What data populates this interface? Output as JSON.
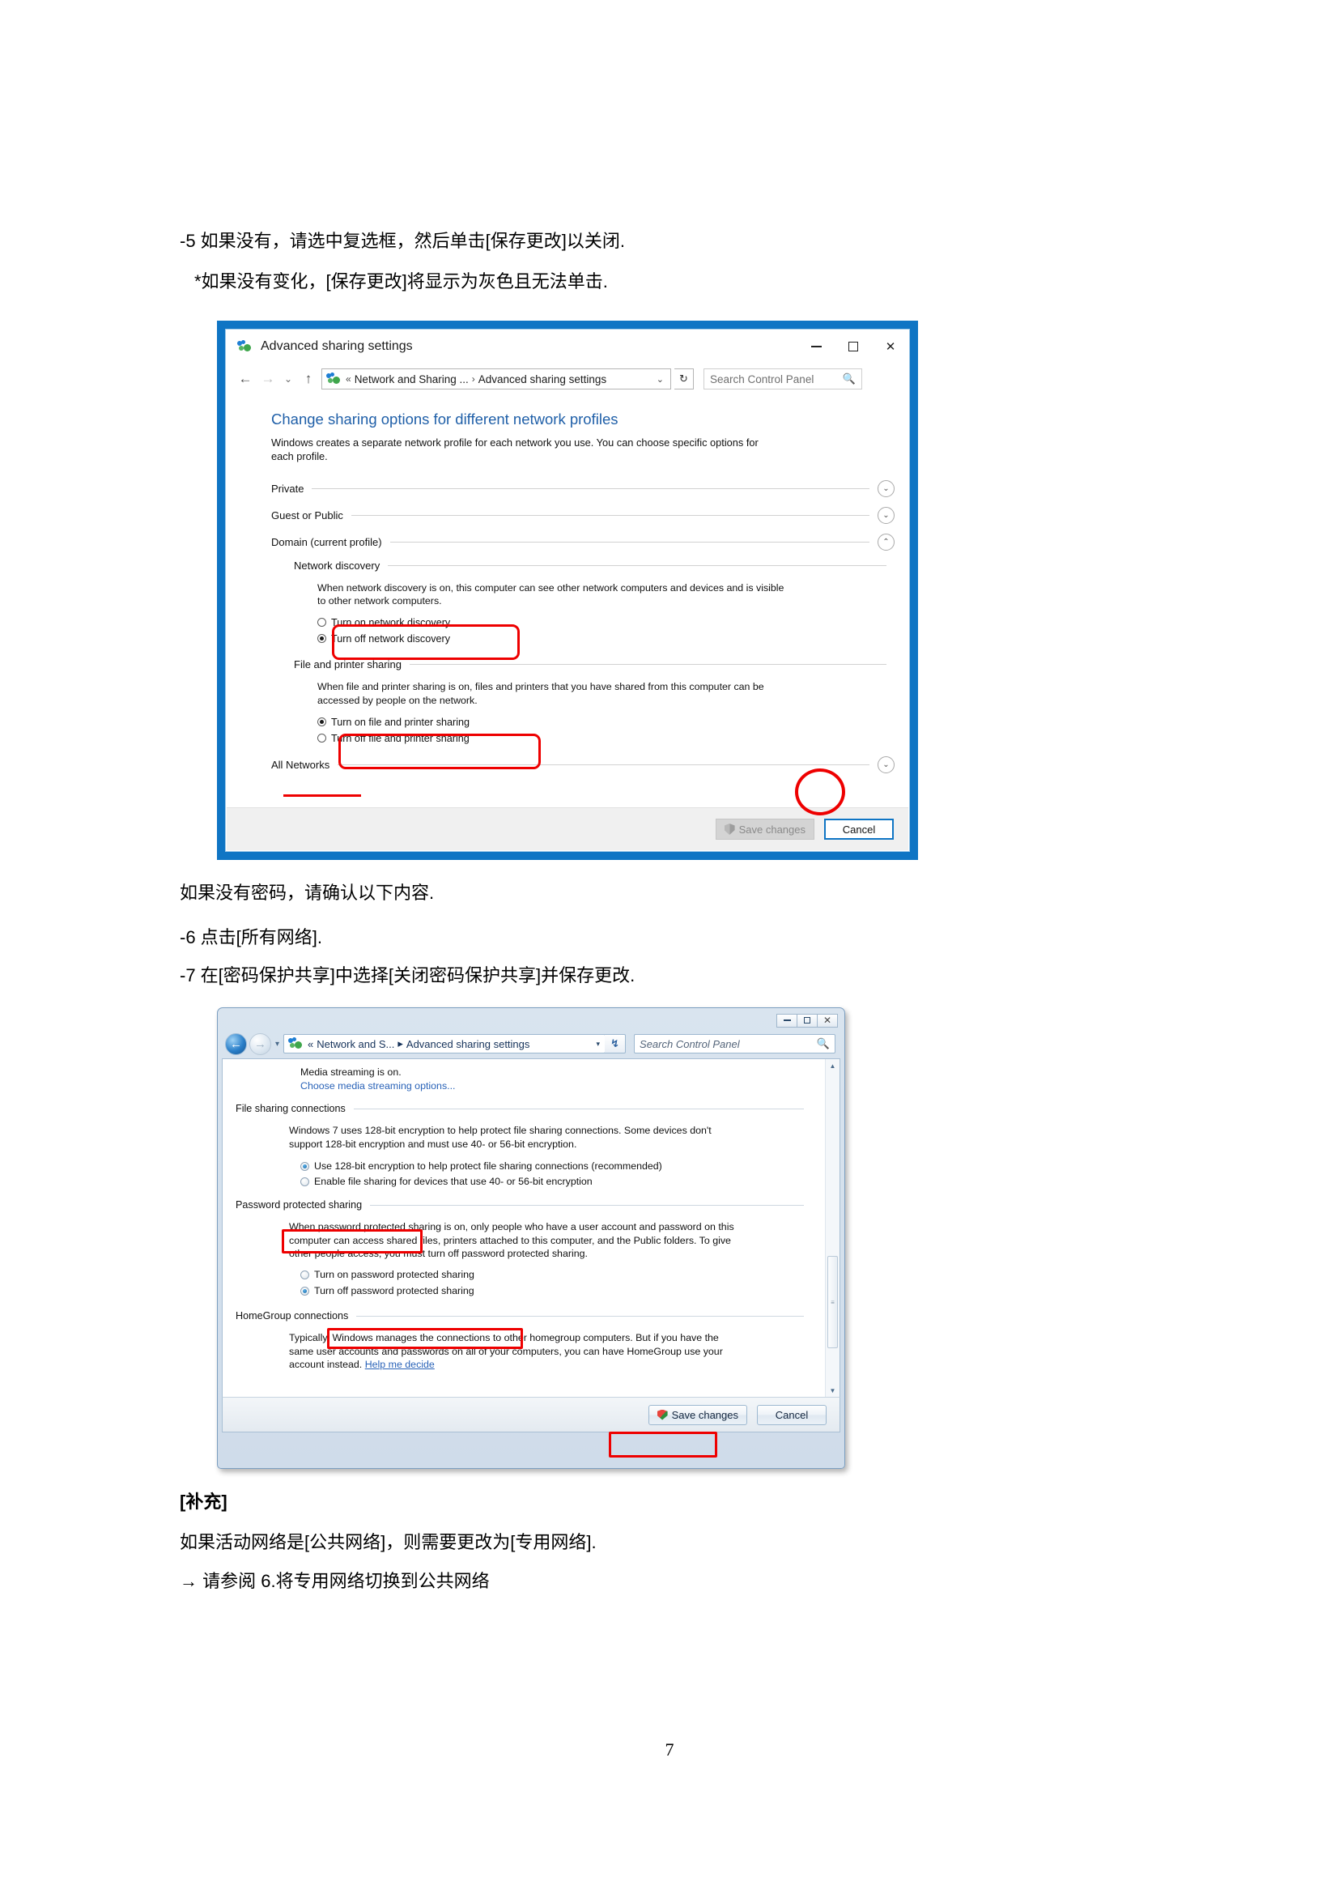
{
  "document": {
    "lines": [
      {
        "id": "l1",
        "text": "-5 如果没有，请选中复选框，然后单击[保存更改]以关闭."
      },
      {
        "id": "l2",
        "text": "*如果没有变化，[保存更改]将显示为灰色且无法单击."
      },
      {
        "id": "l3",
        "text": "如果没有密码，请确认以下内容."
      },
      {
        "id": "l4",
        "text": "-6 点击[所有网络]."
      },
      {
        "id": "l5",
        "text": "-7 在[密码保护共享]中选择[关闭密码保护共享]并保存更改."
      },
      {
        "id": "l6",
        "text": "[补充]"
      },
      {
        "id": "l7",
        "text": "如果活动网络是[公共网络]，则需要更改为[专用网络]."
      },
      {
        "id": "l8",
        "text": "→   请参阅 6.将专用网络切换到公共网络"
      }
    ],
    "page_number": "7"
  },
  "shot1": {
    "window_title": "Advanced sharing settings",
    "titlebar_icon": "network-sharing-icon",
    "window_controls": {
      "minimize": "minimize-icon",
      "maximize": "maximize-icon",
      "close": "✕"
    },
    "nav": {
      "back": "←",
      "forward": "→",
      "recent": "⌄",
      "up": "↑"
    },
    "breadcrumb": {
      "icon": "network-sharing-icon",
      "chevron": "«",
      "part1": "Network and Sharing ...",
      "separator": "›",
      "part2": "Advanced sharing settings",
      "caret": "⌄"
    },
    "refresh_label": "↻",
    "search": {
      "placeholder": "Search Control Panel",
      "icon": "search-icon"
    },
    "heading": "Change sharing options for different network profiles",
    "intro": "Windows creates a separate network profile for each network you use. You can choose specific options for each profile.",
    "sections": [
      {
        "label": "Private",
        "state": "collapsed",
        "chevron": "⌄"
      },
      {
        "label": "Guest or Public",
        "state": "collapsed",
        "chevron": "⌄"
      },
      {
        "label": "Domain (current profile)",
        "state": "expanded",
        "chevron": "⌃"
      }
    ],
    "network_discovery": {
      "label": "Network discovery",
      "description": "When network discovery is on, this computer can see other network computers and devices and is visible to other network computers.",
      "options": [
        {
          "label": "Turn on network discovery",
          "selected": false
        },
        {
          "label": "Turn off network discovery",
          "selected": true
        }
      ]
    },
    "file_printer_sharing": {
      "label": "File and printer sharing",
      "description": "When file and printer sharing is on, files and printers that you have shared from this computer can be accessed by people on the network.",
      "options": [
        {
          "label": "Turn on file and printer sharing",
          "selected": true
        },
        {
          "label": "Turn off file and printer sharing",
          "selected": false
        }
      ]
    },
    "all_networks": {
      "label": "All Networks",
      "chevron": "⌄"
    },
    "buttons": {
      "save": {
        "label": "Save changes",
        "disabled": true,
        "icon": "uac-shield-icon"
      },
      "cancel": {
        "label": "Cancel",
        "default": true
      }
    }
  },
  "shot2": {
    "window_controls": {
      "minimize": "minimize-icon",
      "maximize": "maximize-icon",
      "close": "✕"
    },
    "nav": {
      "back": "←",
      "forward": "→",
      "history_caret": "▾"
    },
    "breadcrumb": {
      "icon": "network-sharing-icon",
      "chevron": "«",
      "part1": "Network and S...",
      "separator": "▸",
      "part2": "Advanced sharing settings",
      "caret": "▾"
    },
    "refresh_label": "↯",
    "search": {
      "placeholder": "Search Control Panel",
      "icon": "search-icon"
    },
    "media_streaming": {
      "status": "Media streaming is on.",
      "link": "Choose media streaming options..."
    },
    "file_sharing_connections": {
      "label": "File sharing connections",
      "description": "Windows 7 uses 128-bit encryption to help protect file sharing connections. Some devices don't support 128-bit encryption and must use 40- or 56-bit encryption.",
      "options": [
        {
          "label": "Use 128-bit encryption to help protect file sharing connections (recommended)",
          "selected": true
        },
        {
          "label": "Enable file sharing for devices that use 40- or 56-bit encryption",
          "selected": false
        }
      ]
    },
    "password_protected_sharing": {
      "label": "Password protected sharing",
      "description": "When password protected sharing is on, only people who have a user account and password on this computer can access shared files, printers attached to this computer, and the Public folders. To give other people access, you must turn off password protected sharing.",
      "options": [
        {
          "label": "Turn on password protected sharing",
          "selected": false
        },
        {
          "label": "Turn off password protected sharing",
          "selected": true
        }
      ]
    },
    "homegroup_connections": {
      "label": "HomeGroup connections",
      "description": "Typically, Windows manages the connections to other homegroup computers. But if you have the same user accounts and passwords on all of your computers, you can have HomeGroup use your account instead.",
      "link": "Help me decide"
    },
    "buttons": {
      "save": {
        "label": "Save changes",
        "icon": "uac-shield-icon"
      },
      "cancel": {
        "label": "Cancel"
      }
    },
    "scrollbar": {
      "up": "▲",
      "down": "▼",
      "grip": "≡"
    }
  },
  "colors": {
    "annotation_red": "#ee0000",
    "screenshot_border_blue": "#0f75c4",
    "heading_blue": "#1f5fa8",
    "link_blue": "#2a63b8"
  }
}
